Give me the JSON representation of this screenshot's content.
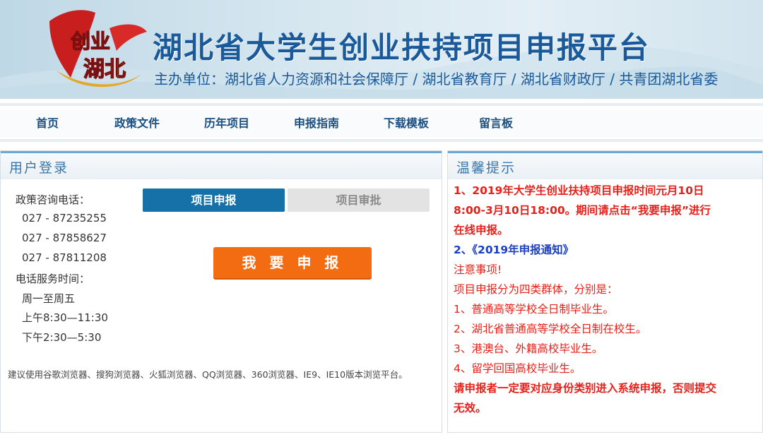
{
  "header": {
    "title": "湖北省大学生创业扶持项目申报平台",
    "sponsors": "主办单位：湖北省人力资源和社会保障厅 / 湖北省教育厅 / 湖北省财政厅 / 共青团湖北省委",
    "logo_text_1": "创业",
    "logo_text_2": "湖北"
  },
  "nav": {
    "items": [
      "首页",
      "政策文件",
      "历年项目",
      "申报指南",
      "下载模板",
      "留言板"
    ]
  },
  "login_panel": {
    "title": "用户登录",
    "contact_label": "政策咨询电话：",
    "phones": [
      "027 - 87235255",
      "027 - 87858627",
      "027 - 87811208"
    ],
    "hours_label": "电话服务时间：",
    "days": "周一至周五",
    "morning": "上午8:30—11:30",
    "afternoon": "下午2:30—5:30",
    "tab_apply": "项目申报",
    "tab_review": "项目审批",
    "apply_button": "我 要 申 报",
    "browser_note": "建议使用谷歌浏览器、搜狗浏览器、火狐浏览器、QQ浏览器、360浏览器、IE9、IE10版本浏览平台。"
  },
  "tips_panel": {
    "title": "温馨提示",
    "line1a": "1、2019年大学生创业扶持项目申报时间元月10日",
    "line1b": "8:00-3月10日18:00。期间请点击“我要申报”进行",
    "line1c": "在线申报。",
    "line2": "2、《2019年申报通知》",
    "notice": "注意事项!",
    "groups_intro": "项目申报分为四类群体，分别是：",
    "group1": "1、普通高等学校全日制毕业生。",
    "group2": "2、湖北省普通高等学校全日制在校生。",
    "group3": "3、港澳台、外籍高校毕业生。",
    "group4": "4、留学回国高校毕业生。",
    "warning_a": "请申报者一定要对应身份类别进入系统申报，否则提交",
    "warning_b": "无效。"
  },
  "colors": {
    "brand_blue": "#1a5a9a",
    "tab_active": "#1571a8",
    "apply_orange": "#f46c11",
    "tip_red": "#e8201a",
    "tip_blue": "#1a3fc2"
  }
}
